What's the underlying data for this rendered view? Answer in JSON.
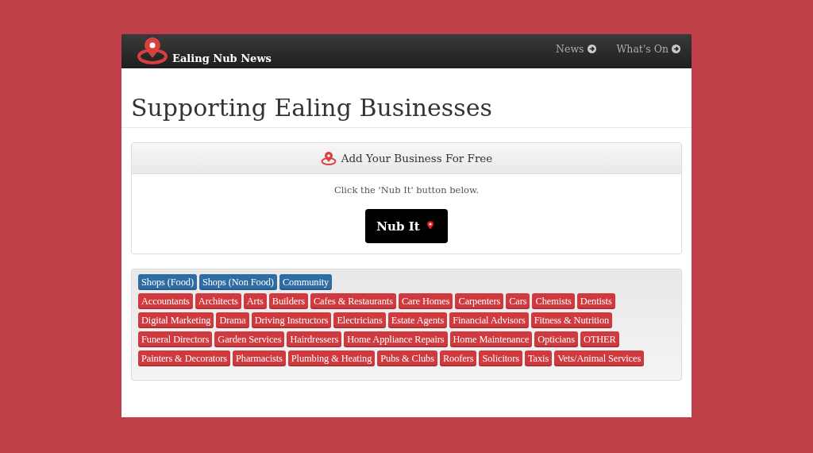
{
  "navbar": {
    "brand": "Ealing Nub News",
    "links": [
      "News",
      "What's On"
    ]
  },
  "page_title": "Supporting Ealing Businesses",
  "card": {
    "header": "Add Your Business For Free",
    "text": "Click the 'Nub It' button below.",
    "button": "Nub It"
  },
  "tag_groups": [
    {
      "tags": [
        {
          "label": "Shops (Food)",
          "color": "#2e6da4"
        },
        {
          "label": "Shops (Non Food)",
          "color": "#2e6da4"
        },
        {
          "label": "Community",
          "color": "#2e6da4"
        }
      ]
    },
    {
      "tags": [
        {
          "label": "Accountants",
          "color": "#d0393e"
        },
        {
          "label": "Architects",
          "color": "#d0393e"
        },
        {
          "label": "Arts",
          "color": "#d0393e"
        },
        {
          "label": "Builders",
          "color": "#d0393e"
        },
        {
          "label": "Cafes & Restaurants",
          "color": "#d0393e"
        },
        {
          "label": "Care Homes",
          "color": "#d0393e"
        },
        {
          "label": "Carpenters",
          "color": "#d0393e"
        },
        {
          "label": "Cars",
          "color": "#d0393e"
        },
        {
          "label": "Chemists",
          "color": "#d0393e"
        },
        {
          "label": "Dentists",
          "color": "#d0393e"
        },
        {
          "label": "Digital Marketing",
          "color": "#d0393e"
        },
        {
          "label": "Drama",
          "color": "#d0393e"
        },
        {
          "label": "Driving Instructors",
          "color": "#d0393e"
        },
        {
          "label": "Electricians",
          "color": "#d0393e"
        },
        {
          "label": "Estate Agents",
          "color": "#d0393e"
        },
        {
          "label": "Financial Advisors",
          "color": "#d0393e"
        },
        {
          "label": "Fitness & Nutrition",
          "color": "#d0393e"
        },
        {
          "label": "Funeral Directors",
          "color": "#d0393e"
        },
        {
          "label": "Garden Services",
          "color": "#d0393e"
        },
        {
          "label": "Hairdressers",
          "color": "#d0393e"
        },
        {
          "label": "Home Appliance Repairs",
          "color": "#d0393e"
        },
        {
          "label": "Home Maintenance",
          "color": "#d0393e"
        },
        {
          "label": "Opticians",
          "color": "#d0393e"
        },
        {
          "label": "OTHER",
          "color": "#d0393e"
        },
        {
          "label": "Painters & Decorators",
          "color": "#d0393e"
        },
        {
          "label": "Pharmacists",
          "color": "#d0393e"
        },
        {
          "label": "Plumbing & Heating",
          "color": "#d0393e"
        },
        {
          "label": "Pubs & Clubs",
          "color": "#d0393e"
        },
        {
          "label": "Roofers",
          "color": "#d0393e"
        },
        {
          "label": "Solicitors",
          "color": "#d0393e"
        },
        {
          "label": "Taxis",
          "color": "#d0393e"
        },
        {
          "label": "Vets/Animal Services",
          "color": "#d0393e"
        }
      ]
    }
  ]
}
